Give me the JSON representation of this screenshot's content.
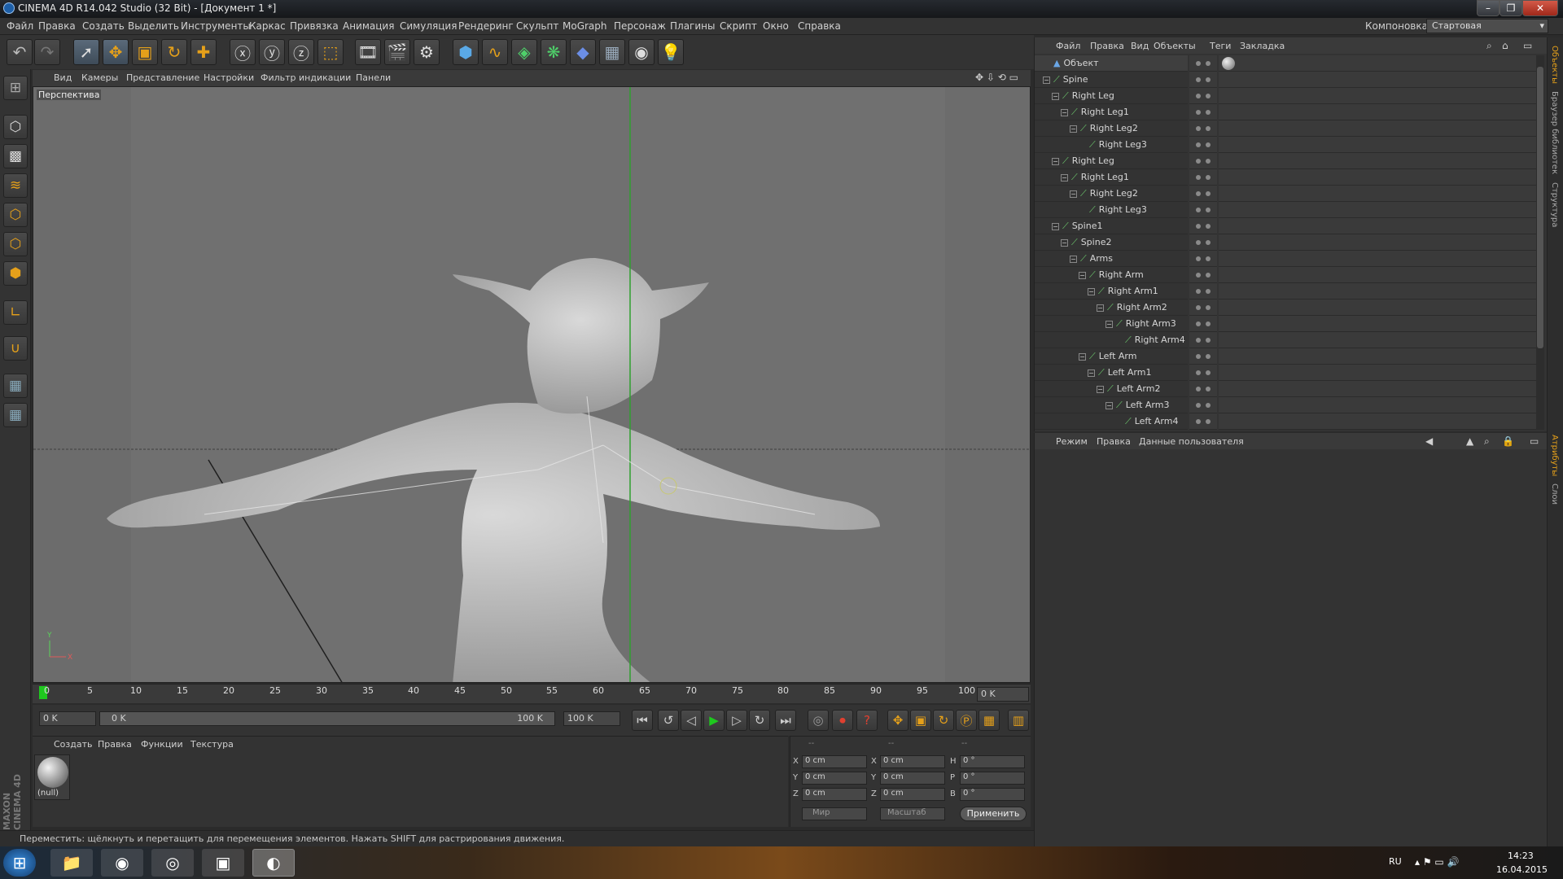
{
  "window": {
    "title": "CINEMA 4D R14.042 Studio (32 Bit) - [Документ 1 *]"
  },
  "menu": {
    "items": [
      "Файл",
      "Правка",
      "Создать",
      "Выделить",
      "Инструменты",
      "Каркас",
      "Привязка",
      "Анимация",
      "Симуляция",
      "Рендеринг",
      "Скульпт",
      "MoGraph",
      "Персонаж",
      "Плагины",
      "Скрипт",
      "Окно",
      "Справка"
    ],
    "layout_label": "Компоновка",
    "layout_value": "Стартовая"
  },
  "viewport": {
    "menu": [
      "Вид",
      "Камеры",
      "Представление",
      "Настройки",
      "Фильтр индикации",
      "Панели"
    ],
    "label": "Перспектива"
  },
  "timeline": {
    "ticks": [
      "0",
      "5",
      "10",
      "15",
      "20",
      "25",
      "30",
      "35",
      "40",
      "45",
      "50",
      "55",
      "60",
      "65",
      "70",
      "75",
      "80",
      "85",
      "90",
      "95",
      "100"
    ],
    "current_frame": "0 K",
    "start": "0 K",
    "range_start": "0 K",
    "range_end": "100 K",
    "end": "100 K"
  },
  "materials": {
    "menu": [
      "Создать",
      "Правка",
      "Функции",
      "Текстура"
    ],
    "item_label": "(null)"
  },
  "coords": {
    "headers": [
      "--",
      "--",
      "--"
    ],
    "rows": [
      {
        "a": "X",
        "av": "0 cm",
        "b": "X",
        "bv": "0 cm",
        "c": "H",
        "cv": "0 °"
      },
      {
        "a": "Y",
        "av": "0 cm",
        "b": "Y",
        "bv": "0 cm",
        "c": "P",
        "cv": "0 °"
      },
      {
        "a": "Z",
        "av": "0 cm",
        "b": "Z",
        "bv": "0 cm",
        "c": "B",
        "cv": "0 °"
      }
    ],
    "world": "Мир",
    "scale": "Масштаб",
    "apply": "Применить"
  },
  "status": "Переместить: щёлкнуть и перетащить для перемещения элементов. Нажать SHIFT для растрирования движения.",
  "objects": {
    "menu": [
      "Файл",
      "Правка",
      "Вид",
      "Объекты",
      "Теги",
      "Закладка"
    ],
    "rows": [
      {
        "name": "Объект",
        "depth": 0,
        "type": "null"
      },
      {
        "name": "Spine",
        "depth": 0,
        "type": "joint"
      },
      {
        "name": "Right Leg",
        "depth": 1,
        "type": "joint"
      },
      {
        "name": "Right Leg1",
        "depth": 2,
        "type": "joint"
      },
      {
        "name": "Right Leg2",
        "depth": 3,
        "type": "joint"
      },
      {
        "name": "Right Leg3",
        "depth": 4,
        "type": "joint"
      },
      {
        "name": "Right Leg",
        "depth": 1,
        "type": "joint"
      },
      {
        "name": "Right Leg1",
        "depth": 2,
        "type": "joint"
      },
      {
        "name": "Right Leg2",
        "depth": 3,
        "type": "joint"
      },
      {
        "name": "Right Leg3",
        "depth": 4,
        "type": "joint"
      },
      {
        "name": "Spine1",
        "depth": 1,
        "type": "joint"
      },
      {
        "name": "Spine2",
        "depth": 2,
        "type": "joint"
      },
      {
        "name": "Arms",
        "depth": 3,
        "type": "joint"
      },
      {
        "name": "Right Arm",
        "depth": 4,
        "type": "joint"
      },
      {
        "name": "Right Arm1",
        "depth": 5,
        "type": "joint"
      },
      {
        "name": "Right Arm2",
        "depth": 6,
        "type": "joint"
      },
      {
        "name": "Right Arm3",
        "depth": 7,
        "type": "joint"
      },
      {
        "name": "Right Arm4",
        "depth": 8,
        "type": "joint"
      },
      {
        "name": "Left Arm",
        "depth": 4,
        "type": "joint"
      },
      {
        "name": "Left Arm1",
        "depth": 5,
        "type": "joint"
      },
      {
        "name": "Left Arm2",
        "depth": 6,
        "type": "joint"
      },
      {
        "name": "Left Arm3",
        "depth": 7,
        "type": "joint"
      },
      {
        "name": "Left Arm4",
        "depth": 8,
        "type": "joint"
      }
    ]
  },
  "attributes": {
    "menu": [
      "Режим",
      "Правка",
      "Данные пользователя"
    ]
  },
  "side_tabs": [
    "Объекты",
    "Браузер библиотек",
    "Структура",
    "Атрибуты",
    "Слои"
  ],
  "branding": "MAXON CINEMA 4D",
  "taskbar": {
    "lang": "RU",
    "time": "14:23",
    "date": "16.04.2015"
  }
}
